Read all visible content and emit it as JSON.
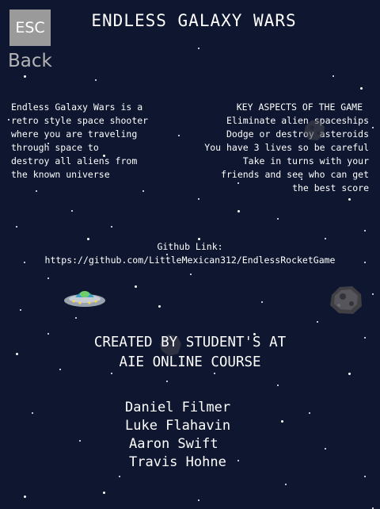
{
  "header": {
    "esc_label": "ESC",
    "back_label": "Back",
    "title": "ENDLESS GALAXY WARS"
  },
  "description": {
    "text": "Endless Galaxy Wars is a\nretro style space shooter\nwhere you are traveling\nthrough space to\ndestroy all aliens from\nthe known universe"
  },
  "aspects": {
    "heading": "KEY ASPECTS OF THE GAME",
    "lines": [
      "Eliminate alien spaceships",
      "Dodge or destroy asteroids",
      "You have 3 lives so be careful",
      "Take in turns with your",
      "friends and see who can get",
      "the best score"
    ]
  },
  "github": {
    "label": "Github Link:",
    "url": "https://github.com/LittleMexican312/EndlessRocketGame"
  },
  "credits": {
    "line1": "CREATED BY STUDENT'S AT",
    "line2": "AIE ONLINE COURSE",
    "names": [
      "Daniel Filmer",
      "Luke Flahavin",
      "Aaron Swift",
      "Travis Hohne"
    ]
  },
  "sprites": {
    "ufo": "ufo-icon",
    "asteroid": "asteroid-icon"
  },
  "colors": {
    "background": "#0e1630",
    "esc_button": "#9a9a9a",
    "back_text": "#b5b5b5",
    "text": "#ffffff"
  }
}
